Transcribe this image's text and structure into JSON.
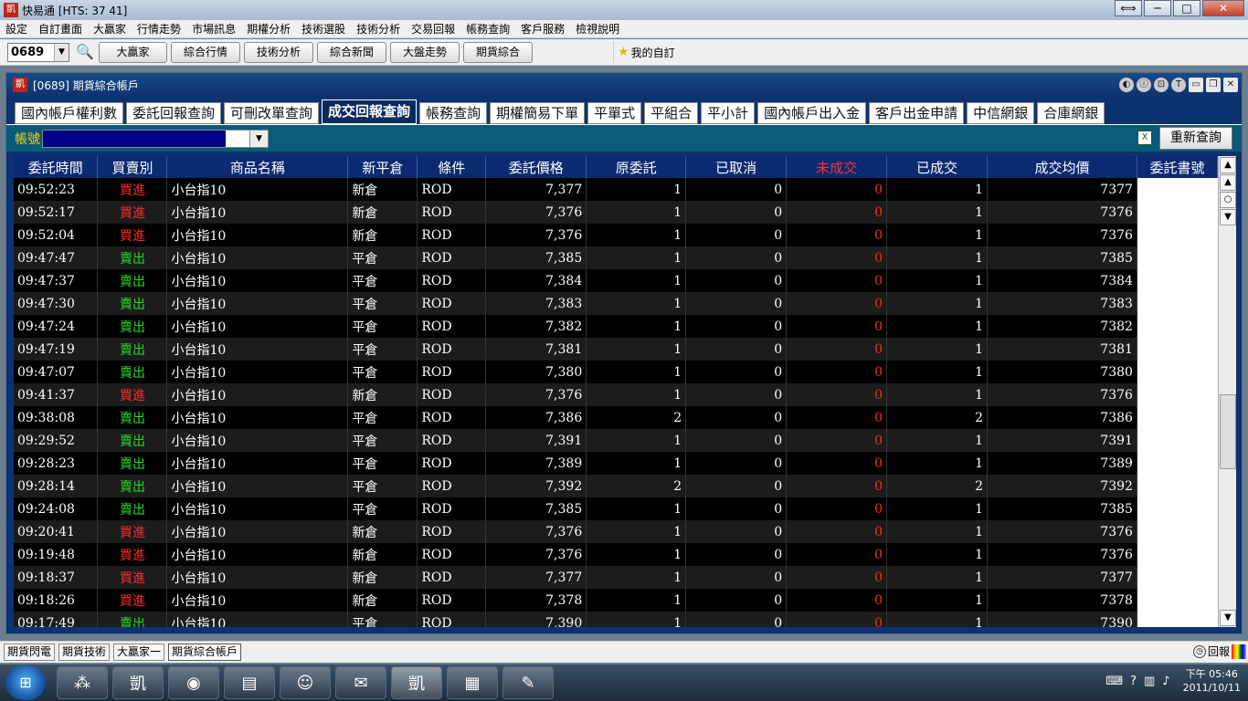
{
  "app": {
    "logo": "凱",
    "title": "快易通  [HTS: 37 41]"
  },
  "window_controls": {
    "swap": "⟺",
    "minimize": "─",
    "maximize": "□",
    "close": "✕"
  },
  "menu": [
    "設定",
    "自訂畫面",
    "大贏家",
    "行情走勢",
    "市場訊息",
    "期權分析",
    "技術選股",
    "技術分析",
    "交易回報",
    "帳務查詢",
    "客戶服務",
    "檢視說明"
  ],
  "toolbar": {
    "code": "0689",
    "buttons": [
      "大贏家",
      "綜合行情",
      "技術分析",
      "綜合新聞",
      "大盤走勢",
      "期貨綜合"
    ],
    "favorites": "我的自訂"
  },
  "frame": {
    "title": "[0689] 期貨綜合帳戶",
    "controls": [
      "◐",
      "ⓘ",
      "⊡",
      "T",
      "▭",
      "❐",
      "✕"
    ]
  },
  "tabs": [
    "國內帳戶權利數",
    "委託回報查詢",
    "可刪改單查詢",
    "成交回報查詢",
    "帳務查詢",
    "期權簡易下單",
    "平單式",
    "平組合",
    "平小計",
    "國內帳戶出入金",
    "客戶出金申請",
    "中信網銀",
    "合庫網銀"
  ],
  "active_tab": "成交回報查詢",
  "account": {
    "label": "帳號",
    "requery": "重新查詢"
  },
  "columns": [
    "委託時間",
    "買賣別",
    "商品名稱",
    "新平倉",
    "條件",
    "委託價格",
    "原委託",
    "已取消",
    "未成交",
    "已成交",
    "成交均價",
    "委託書號"
  ],
  "rows": [
    {
      "time": "09:52:23",
      "side": "買進",
      "product": "小台指10",
      "oc": "新倉",
      "cond": "ROD",
      "price": "7,377",
      "orig": "1",
      "cancel": "0",
      "unfilled": "0",
      "filled": "1",
      "avg": "7377"
    },
    {
      "time": "09:52:17",
      "side": "買進",
      "product": "小台指10",
      "oc": "新倉",
      "cond": "ROD",
      "price": "7,376",
      "orig": "1",
      "cancel": "0",
      "unfilled": "0",
      "filled": "1",
      "avg": "7376"
    },
    {
      "time": "09:52:04",
      "side": "買進",
      "product": "小台指10",
      "oc": "新倉",
      "cond": "ROD",
      "price": "7,376",
      "orig": "1",
      "cancel": "0",
      "unfilled": "0",
      "filled": "1",
      "avg": "7376"
    },
    {
      "time": "09:47:47",
      "side": "賣出",
      "product": "小台指10",
      "oc": "平倉",
      "cond": "ROD",
      "price": "7,385",
      "orig": "1",
      "cancel": "0",
      "unfilled": "0",
      "filled": "1",
      "avg": "7385"
    },
    {
      "time": "09:47:37",
      "side": "賣出",
      "product": "小台指10",
      "oc": "平倉",
      "cond": "ROD",
      "price": "7,384",
      "orig": "1",
      "cancel": "0",
      "unfilled": "0",
      "filled": "1",
      "avg": "7384"
    },
    {
      "time": "09:47:30",
      "side": "賣出",
      "product": "小台指10",
      "oc": "平倉",
      "cond": "ROD",
      "price": "7,383",
      "orig": "1",
      "cancel": "0",
      "unfilled": "0",
      "filled": "1",
      "avg": "7383"
    },
    {
      "time": "09:47:24",
      "side": "賣出",
      "product": "小台指10",
      "oc": "平倉",
      "cond": "ROD",
      "price": "7,382",
      "orig": "1",
      "cancel": "0",
      "unfilled": "0",
      "filled": "1",
      "avg": "7382"
    },
    {
      "time": "09:47:19",
      "side": "賣出",
      "product": "小台指10",
      "oc": "平倉",
      "cond": "ROD",
      "price": "7,381",
      "orig": "1",
      "cancel": "0",
      "unfilled": "0",
      "filled": "1",
      "avg": "7381"
    },
    {
      "time": "09:47:07",
      "side": "賣出",
      "product": "小台指10",
      "oc": "平倉",
      "cond": "ROD",
      "price": "7,380",
      "orig": "1",
      "cancel": "0",
      "unfilled": "0",
      "filled": "1",
      "avg": "7380"
    },
    {
      "time": "09:41:37",
      "side": "買進",
      "product": "小台指10",
      "oc": "新倉",
      "cond": "ROD",
      "price": "7,376",
      "orig": "1",
      "cancel": "0",
      "unfilled": "0",
      "filled": "1",
      "avg": "7376"
    },
    {
      "time": "09:38:08",
      "side": "賣出",
      "product": "小台指10",
      "oc": "平倉",
      "cond": "ROD",
      "price": "7,386",
      "orig": "2",
      "cancel": "0",
      "unfilled": "0",
      "filled": "2",
      "avg": "7386"
    },
    {
      "time": "09:29:52",
      "side": "賣出",
      "product": "小台指10",
      "oc": "平倉",
      "cond": "ROD",
      "price": "7,391",
      "orig": "1",
      "cancel": "0",
      "unfilled": "0",
      "filled": "1",
      "avg": "7391"
    },
    {
      "time": "09:28:23",
      "side": "賣出",
      "product": "小台指10",
      "oc": "平倉",
      "cond": "ROD",
      "price": "7,389",
      "orig": "1",
      "cancel": "0",
      "unfilled": "0",
      "filled": "1",
      "avg": "7389"
    },
    {
      "time": "09:28:14",
      "side": "賣出",
      "product": "小台指10",
      "oc": "平倉",
      "cond": "ROD",
      "price": "7,392",
      "orig": "2",
      "cancel": "0",
      "unfilled": "0",
      "filled": "2",
      "avg": "7392"
    },
    {
      "time": "09:24:08",
      "side": "賣出",
      "product": "小台指10",
      "oc": "平倉",
      "cond": "ROD",
      "price": "7,385",
      "orig": "1",
      "cancel": "0",
      "unfilled": "0",
      "filled": "1",
      "avg": "7385"
    },
    {
      "time": "09:20:41",
      "side": "買進",
      "product": "小台指10",
      "oc": "新倉",
      "cond": "ROD",
      "price": "7,376",
      "orig": "1",
      "cancel": "0",
      "unfilled": "0",
      "filled": "1",
      "avg": "7376"
    },
    {
      "time": "09:19:48",
      "side": "買進",
      "product": "小台指10",
      "oc": "新倉",
      "cond": "ROD",
      "price": "7,376",
      "orig": "1",
      "cancel": "0",
      "unfilled": "0",
      "filled": "1",
      "avg": "7376"
    },
    {
      "time": "09:18:37",
      "side": "買進",
      "product": "小台指10",
      "oc": "新倉",
      "cond": "ROD",
      "price": "7,377",
      "orig": "1",
      "cancel": "0",
      "unfilled": "0",
      "filled": "1",
      "avg": "7377"
    },
    {
      "time": "09:18:26",
      "side": "買進",
      "product": "小台指10",
      "oc": "新倉",
      "cond": "ROD",
      "price": "7,378",
      "orig": "1",
      "cancel": "0",
      "unfilled": "0",
      "filled": "1",
      "avg": "7378"
    },
    {
      "time": "09:17:49",
      "side": "賣出",
      "product": "小台指10",
      "oc": "平倉",
      "cond": "ROD",
      "price": "7,390",
      "orig": "1",
      "cancel": "0",
      "unfilled": "0",
      "filled": "1",
      "avg": "7390"
    }
  ],
  "statusbar": {
    "tabs": [
      "期貨閃電",
      "期貨技術",
      "大贏家一",
      "期貨綜合帳戶"
    ],
    "reply": "回報"
  },
  "taskbar": {
    "clock_time": "下午 05:46",
    "clock_date": "2011/10/11"
  },
  "colors": {
    "buy": "#ff2a2a",
    "sell": "#22dd22",
    "header_bg": "#0a2a72",
    "frame_bg": "#0c3370"
  }
}
